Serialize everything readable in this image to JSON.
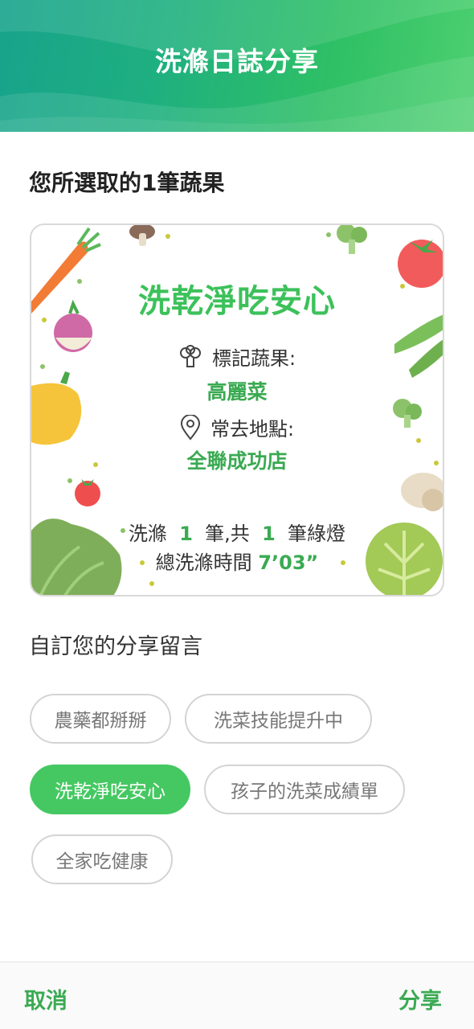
{
  "header": {
    "title": "洗滌日誌分享"
  },
  "selection": {
    "title": "您所選取的1筆蔬果"
  },
  "card": {
    "slogan": "洗乾淨吃安心",
    "veg_label": "標記蔬果:",
    "veg_value": "高麗菜",
    "place_label": "常去地點:",
    "place_value": "全聯成功店",
    "stat_prefix": "洗滌",
    "stat_wash_count": "1",
    "stat_middle": "筆,共",
    "stat_green_count": "1",
    "stat_suffix": "筆綠燈",
    "time_label": "總洗滌時間",
    "time_value": "7’03”",
    "icons": [
      "broccoli-icon",
      "location-pin-icon"
    ]
  },
  "message": {
    "title": "自訂您的分享留言",
    "chips": [
      {
        "label": "農藥都掰掰",
        "selected": false
      },
      {
        "label": "洗菜技能提升中",
        "selected": false
      },
      {
        "label": "洗乾淨吃安心",
        "selected": true
      },
      {
        "label": "孩子的洗菜成績單",
        "selected": false
      },
      {
        "label": "全家吃健康",
        "selected": false
      }
    ]
  },
  "footer": {
    "cancel_label": "取消",
    "share_label": "分享"
  },
  "colors": {
    "accent": "#3aaa52",
    "chip_selected": "#45c862",
    "header_start": "#17a38c",
    "header_end": "#4ed070"
  }
}
